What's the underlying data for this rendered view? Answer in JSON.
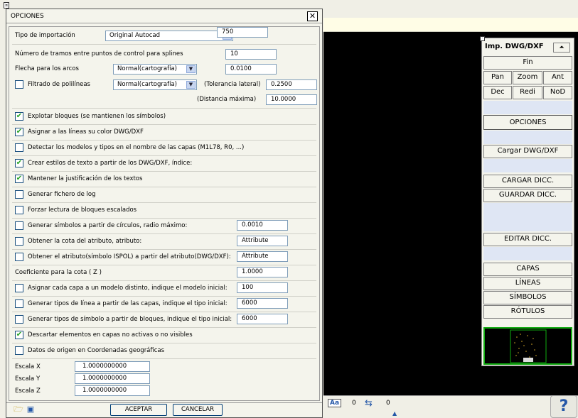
{
  "dialog": {
    "title": "OPCIONES",
    "close": "✕",
    "tipo_importacion_label": "Tipo de importación",
    "tipo_importacion_value": "Original Autocad",
    "tramos_label": "Número de tramos entre puntos de control para splines",
    "tramos_value": "10",
    "flecha_label": "Flecha para los arcos",
    "flecha_mode": "Normal(cartografía)",
    "flecha_value": "0.0100",
    "filtrado_label": "Filtrado de polilíneas",
    "filtrado_mode": "Normal(cartografía)",
    "tolerancia_label": "(Tolerancia lateral)",
    "tolerancia_value": "0.2500",
    "distancia_label": "(Distancia máxima)",
    "distancia_value": "10.0000",
    "explotar_label": "Explotar bloques (se mantienen los símbolos)",
    "asignar_color_label": "Asignar a las líneas su color DWG/DXF",
    "detectar_label": "Detectar los modelos y tipos en el nombre de las capas (M1L78, R0, ...)",
    "crear_estilos_label": "Crear estilos de texto a partir de los DWG/DXF, índice:",
    "crear_estilos_value": "750",
    "mantener_label": "Mantener la justificación de los textos",
    "generar_log_label": "Generar fichero de log",
    "forzar_label": "Forzar lectura de bloques escalados",
    "generar_simbolos_label": "Generar símbolos a partir de círculos, radio máximo:",
    "generar_simbolos_value": "0.0010",
    "obtener_cota_label": "Obtener la cota del atributo, atributo:",
    "obtener_cota_value": "Attribute",
    "obtener_atributo_label": "Obtener el atributo(símbolo ISPOL) a partir del atributo(DWG/DXF):",
    "obtener_atributo_value": "Attribute",
    "coeficiente_label": "Coeficiente para la cota ( Z )",
    "coeficiente_value": "1.0000",
    "asignar_capa_label": "Asignar cada capa a un modelo distinto, indique el modelo inicial:",
    "asignar_capa_value": "100",
    "generar_linea_label": "Generar tipos de línea a partir de las capas, indique el tipo inicial:",
    "generar_linea_value": "6000",
    "generar_simbolo_label": "Generar tipos de símbolo a partir de bloques, indique el tipo inicial:",
    "generar_simbolo_value": "6000",
    "descartar_label": "Descartar elementos en capas no activas o no visibles",
    "datos_origen_label": "Datos de origen en Coordenadas geográficas",
    "escala_x_label": "Escala X",
    "escala_x_value": "1.0000000000",
    "escala_y_label": "Escala Y",
    "escala_y_value": "1.0000000000",
    "escala_z_label": "Escala Z",
    "escala_z_value": "1.0000000000",
    "aceptar": "ACEPTAR",
    "cancelar": "CANCELAR",
    "checks": {
      "filtrado": false,
      "explotar": true,
      "asignar_color": true,
      "detectar": false,
      "crear_estilos": true,
      "mantener": true,
      "generar_log": false,
      "forzar": false,
      "generar_simbolos": false,
      "obtener_cota": false,
      "obtener_atributo": false,
      "asignar_capa": false,
      "generar_linea": false,
      "generar_simbolo": false,
      "descartar": true,
      "datos_origen": false
    }
  },
  "palette": {
    "title": "Imp. DWG/DXF",
    "fin": "Fin",
    "pan": "Pan",
    "zoom": "Zoom",
    "ant": "Ant",
    "dec": "Dec",
    "redi": "Redi",
    "nod": "NoD",
    "opciones": "OPCIONES",
    "cargar_dwg": "Cargar DWG/DXF",
    "cargar_dicc": "CARGAR DICC.",
    "guardar_dicc": "GUARDAR DICC.",
    "editar_dicc": "EDITAR DICC.",
    "capas": "CAPAS",
    "lineas": "LÍNEAS",
    "simbolos": "SÍMBOLOS",
    "rotulos": "RÓTULOS"
  },
  "statusbar": {
    "aa": "Aa",
    "count1": "0",
    "count2": "0",
    "help": "?"
  },
  "colors": {
    "accent": "#21a121",
    "canvas": "#000000",
    "minimap_border": "#11aa11"
  }
}
